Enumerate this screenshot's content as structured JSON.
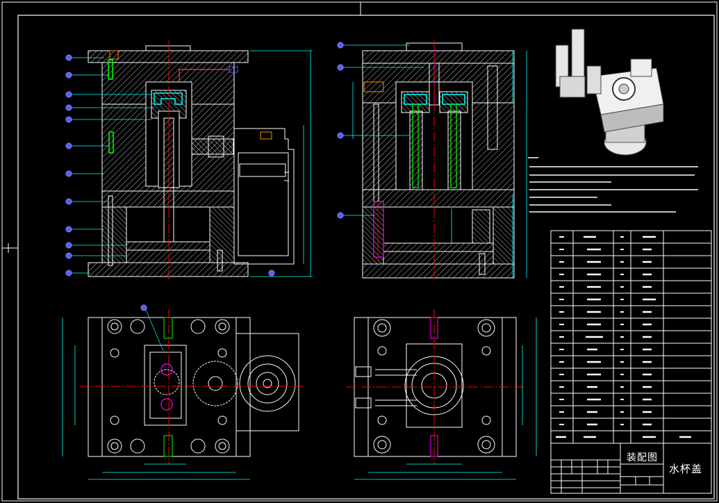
{
  "drawing": {
    "title_assembly": "装配图",
    "title_part": "水杯盖"
  },
  "colors": {
    "background": "#000000",
    "line_white": "#ffffff",
    "dimension_cyan": "#00ffff",
    "centerline_red": "#ff0000",
    "hatch": "#c8c8c8",
    "green": "#00ff00",
    "magenta": "#ff00ff",
    "blue_balloon": "#5a5aff",
    "yellow": "#ffff00"
  },
  "icons": {
    "render_3d": "mold-3d-render",
    "balloon": "part-balloon"
  }
}
